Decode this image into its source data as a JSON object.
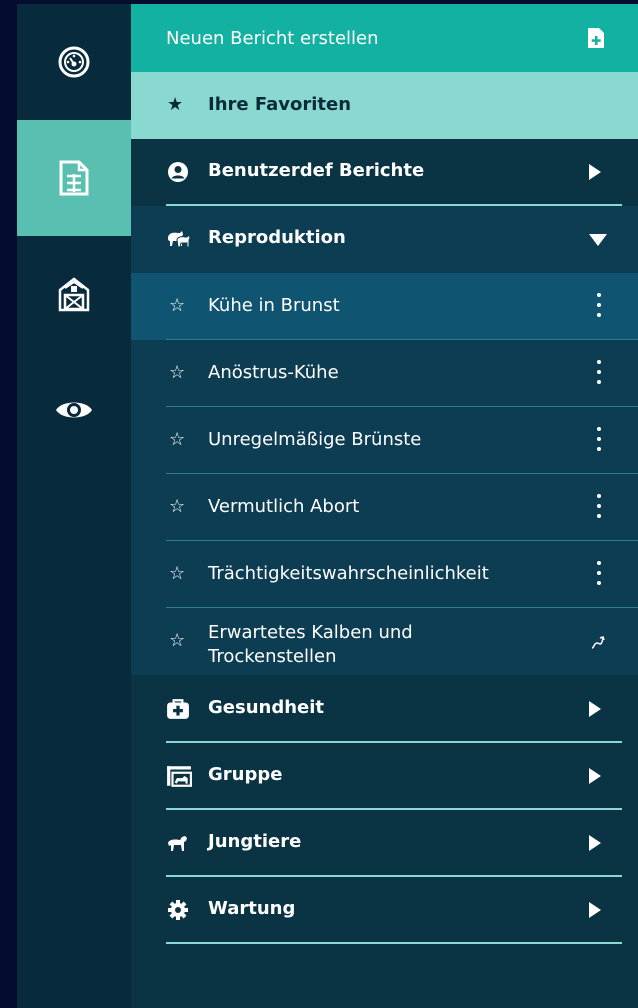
{
  "rail": {
    "items": [
      {
        "icon": "dashboard-gauge-icon",
        "active": false
      },
      {
        "icon": "reports-document-icon",
        "active": true
      },
      {
        "icon": "barn-icon",
        "active": false
      },
      {
        "icon": "eye-icon",
        "active": false
      }
    ]
  },
  "create_report": {
    "label": "Neuen Bericht erstellen",
    "icon": "add-file-icon"
  },
  "favorites": {
    "label": "Ihre Favoriten",
    "star": "★"
  },
  "sections": {
    "custom": {
      "label": "Benutzerdef Berichte",
      "icon": "user-circle-icon",
      "expanded": false
    },
    "reproduction": {
      "label": "Reproduktion",
      "icon": "cow-pair-icon",
      "expanded": true
    },
    "health": {
      "label": "Gesundheit",
      "icon": "medical-kit-icon",
      "expanded": false
    },
    "group": {
      "label": "Gruppe",
      "icon": "pen-group-icon",
      "expanded": false
    },
    "young": {
      "label": "Jungtiere",
      "icon": "calf-icon",
      "expanded": false
    },
    "maintenance": {
      "label": "Wartung",
      "icon": "gear-icon",
      "expanded": false
    }
  },
  "reports": [
    {
      "label": "Kühe in Brunst",
      "star": "☆",
      "selected": true
    },
    {
      "label": "Anöstrus-Kühe",
      "star": "☆",
      "selected": false
    },
    {
      "label": "Unregelmäßige Brünste",
      "star": "☆",
      "selected": false
    },
    {
      "label": "Vermutlich Abort",
      "star": "☆",
      "selected": false
    },
    {
      "label": "Trächtigkeitswahrscheinlichkeit",
      "star": "☆",
      "selected": false
    },
    {
      "label": "Erwartetes Kalben und Trockenstellen",
      "star": "☆",
      "selected": false
    }
  ],
  "colors": {
    "accent_teal": "#12b1a1",
    "favorites_bg": "#8ad9d1",
    "rail_active": "#59bfb0",
    "panel_bg": "#0a3444",
    "selected_bg": "#0f5470"
  }
}
